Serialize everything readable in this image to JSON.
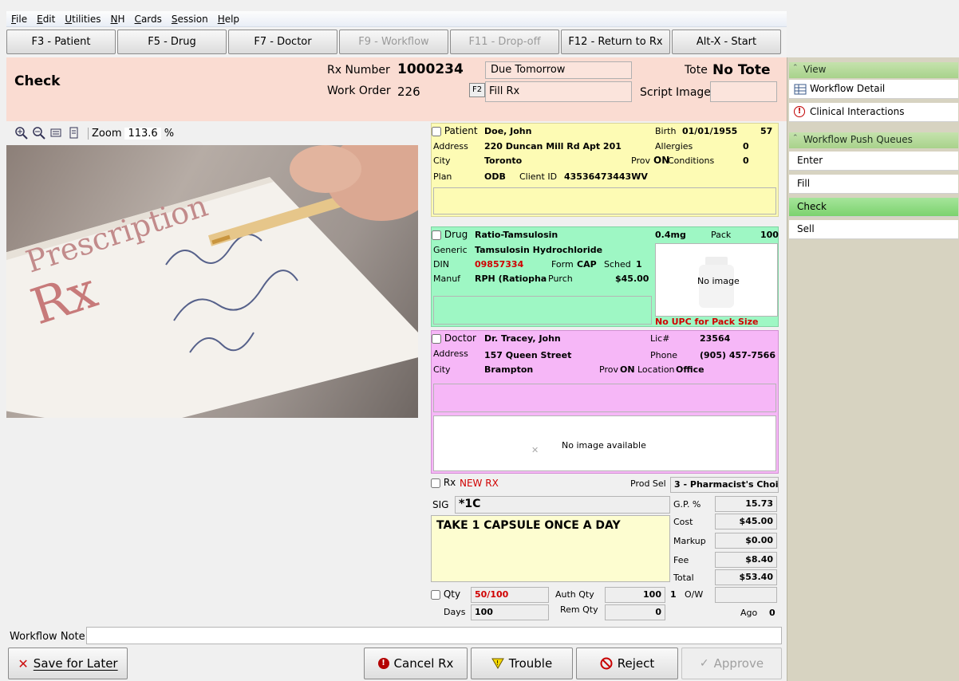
{
  "menu": [
    "File",
    "Edit",
    "Utilities",
    "NH",
    "Cards",
    "Session",
    "Help"
  ],
  "fkeys": [
    {
      "label": "F3 - Patient",
      "enabled": true
    },
    {
      "label": "F5 - Drug",
      "enabled": true
    },
    {
      "label": "F7 - Doctor",
      "enabled": true
    },
    {
      "label": "F9 - Workflow",
      "enabled": false
    },
    {
      "label": "F11 - Drop-off",
      "enabled": false
    },
    {
      "label": "F12 - Return to Rx",
      "enabled": true
    },
    {
      "label": "Alt-X - Start",
      "enabled": true
    }
  ],
  "header": {
    "title": "Check",
    "rx_number_label": "Rx Number",
    "rx_number": "1000234",
    "due": "Due Tomorrow",
    "tote_label": "Tote",
    "tote": "No Tote",
    "work_order_label": "Work Order",
    "work_order": "226",
    "f2": "F2",
    "fill": "Fill Rx",
    "script_image_label": "Script Image"
  },
  "toolbar": {
    "zoom_label": "Zoom",
    "zoom": "113.6",
    "percent": "%"
  },
  "patient": {
    "label": "Patient",
    "name": "Doe, John",
    "birth_label": "Birth",
    "birth": "01/01/1955",
    "age": "57",
    "address_label": "Address",
    "address": "220 Duncan Mill Rd Apt 201",
    "allergies_label": "Allergies",
    "allergies": "0",
    "city_label": "City",
    "city": "Toronto",
    "prov_label": "Prov",
    "prov": "ON",
    "conditions_label": "Conditions",
    "conditions": "0",
    "plan_label": "Plan",
    "plan": "ODB",
    "client_id_label": "Client ID",
    "client_id": "43536473443WV"
  },
  "drug": {
    "label": "Drug",
    "name": "Ratio-Tamsulosin",
    "strength": "0.4mg",
    "pack_label": "Pack",
    "pack": "100",
    "generic_label": "Generic",
    "generic": "Tamsulosin Hydrochloride",
    "din_label": "DIN",
    "din": "09857334",
    "form_label": "Form",
    "form": "CAP",
    "sched_label": "Sched",
    "sched": "1",
    "manuf_label": "Manuf",
    "manuf": "RPH (Ratiopha",
    "purch_label": "Purch",
    "purch": "$45.00",
    "no_image": "No image",
    "no_upc": "No UPC for Pack Size"
  },
  "doctor": {
    "label": "Doctor",
    "name": "Dr. Tracey, John",
    "lic_label": "Lic#",
    "lic": "23564",
    "address_label": "Address",
    "address": "157 Queen Street",
    "phone_label": "Phone",
    "phone": "(905) 457-7566",
    "city_label": "City",
    "city": "Brampton",
    "prov_label": "Prov",
    "prov": "ON",
    "location_label": "Location",
    "location": "Office",
    "no_image": "No image available"
  },
  "rx": {
    "label": "Rx",
    "status": "NEW RX",
    "prod_sel_label": "Prod Sel",
    "prod_sel": "3 - Pharmacist's Choi",
    "sig_label": "SIG",
    "sig": "*1C",
    "sig_text": "TAKE 1 CAPSULE ONCE A DAY",
    "gp_label": "G.P. %",
    "gp": "15.73",
    "cost_label": "Cost",
    "cost": "$45.00",
    "markup_label": "Markup",
    "markup": "$0.00",
    "fee_label": "Fee",
    "fee": "$8.40",
    "total_label": "Total",
    "total": "$53.40",
    "qty_label": "Qty",
    "qty": "50/100",
    "auth_qty_label": "Auth Qty",
    "auth_qty": "100",
    "auth_refills": "1",
    "ow_label": "O/W",
    "days_label": "Days",
    "days": "100",
    "rem_qty_label": "Rem Qty",
    "rem_qty": "0",
    "ago_label": "Ago",
    "ago": "0"
  },
  "workflow_note": {
    "label": "Workflow Note",
    "value": ""
  },
  "buttons": {
    "save": "Save for Later",
    "cancel": "Cancel Rx",
    "trouble": "Trouble",
    "reject": "Reject",
    "approve": "Approve"
  },
  "sidebar": {
    "view_label": "View",
    "view_items": [
      "Workflow Detail",
      "Clinical Interactions"
    ],
    "queues_label": "Workflow Push Queues",
    "queues": [
      "Enter",
      "Fill",
      "Check",
      "Sell"
    ],
    "active_queue": "Check"
  },
  "colors": {
    "header_bg": "#fadcd2",
    "patient_bg": "#fdfbb4",
    "drug_bg": "#9ef7c4",
    "doctor_bg": "#f6b7f7",
    "rx_bg": "#fdfdd0",
    "active_queue": "#7cd26e"
  }
}
